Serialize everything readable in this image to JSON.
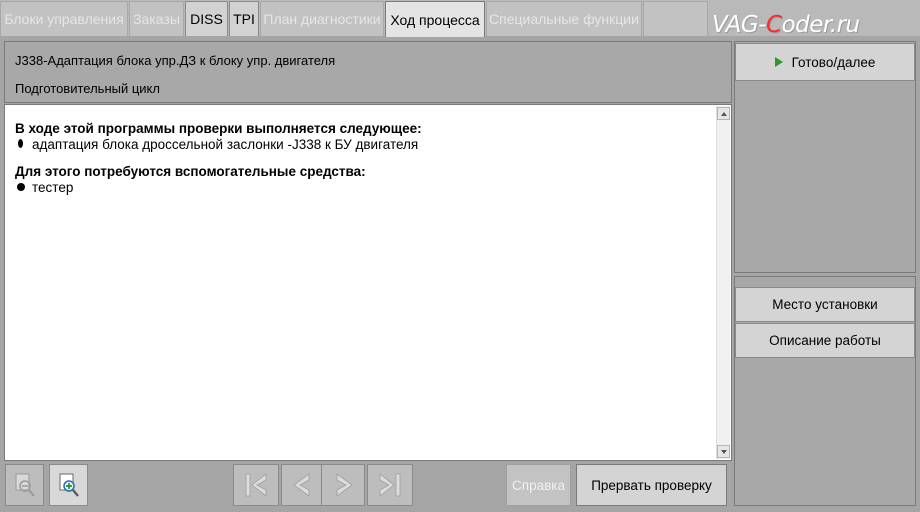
{
  "tabs": [
    {
      "label": "Блоки управления",
      "state": "disabled"
    },
    {
      "label": "Заказы",
      "state": "disabled"
    },
    {
      "label": "DISS",
      "state": "enabled"
    },
    {
      "label": "TPI",
      "state": "enabled"
    },
    {
      "label": "План диагностики",
      "state": "disabled"
    },
    {
      "label": "Ход процесса",
      "state": "active"
    },
    {
      "label": "Специальные функции",
      "state": "disabled"
    }
  ],
  "logo": {
    "prefix": "VAG-",
    "accent_letter": "C",
    "suffix": "oder.ru",
    "accent_color": "#ff2a2a"
  },
  "header": {
    "title": "J338-Адаптация блока упр.ДЗ к блоку упр. двигателя",
    "subtitle": "Подготовительный цикл"
  },
  "content": {
    "section1_heading": "В ходе этой программы проверки выполняется следующее:",
    "section1_items": [
      "адаптация блока дроссельной заслонки -J338 к БУ двигателя"
    ],
    "section2_heading": "Для этого потребуются вспомогательные средства:",
    "section2_items": [
      "тестер"
    ]
  },
  "toolbar": {
    "zoom_out_icon": "zoom-out-icon",
    "zoom_in_icon": "zoom-in-icon",
    "first_icon": "first-page-icon",
    "prev_icon": "prev-page-icon",
    "next_icon": "next-page-icon",
    "last_icon": "last-page-icon",
    "help_label": "Справка",
    "abort_label": "Прервать проверку"
  },
  "side": {
    "next_label": "Готово/далее",
    "next_icon_color": "#2a9a2a",
    "location_label": "Место установки",
    "description_label": "Описание работы"
  }
}
